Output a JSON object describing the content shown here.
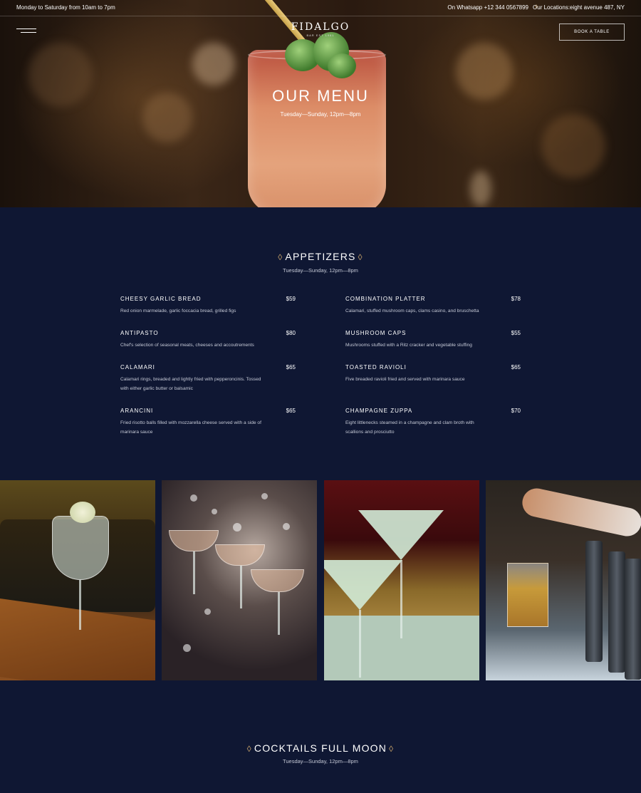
{
  "topbar": {
    "hours": "Monday to Saturday from 10am to 7pm",
    "whatsapp": "On Whatsapp +12 344 0567899",
    "location": "Our Locations:eight avenue 487, NY"
  },
  "logo": {
    "name": "FIDALGO",
    "tagline": "BAR EST 1961"
  },
  "book_button": "BOOK A TABLE",
  "hero": {
    "title": "OUR MENU",
    "subtitle": "Tuesday—Sunday, 12pm—8pm"
  },
  "appetizers": {
    "title": "APPETIZERS",
    "subtitle": "Tuesday—Sunday, 12pm—8pm",
    "items": [
      {
        "name": "CHEESY GARLIC BREAD",
        "price": "$59",
        "desc": "Red onion marmelade, garlic foccacia bread, grilled figs"
      },
      {
        "name": "COMBINATION PLATTER",
        "price": "$78",
        "desc": "Calamari, stuffed mushroom caps, clams casino, and bruschetta"
      },
      {
        "name": "ANTIPASTO",
        "price": "$80",
        "desc": "Chef's selection of seasonal meats, cheeses and accoutrements"
      },
      {
        "name": "MUSHROOM CAPS",
        "price": "$55",
        "desc": "Mushrooms stuffed with a Ritz cracker and vegetable stuffing"
      },
      {
        "name": "CALAMARI",
        "price": "$65",
        "desc": "Calamari rings, breaded and lightly fried with pepperoncinis. Tossed with either garlic butter or balsamic"
      },
      {
        "name": "TOASTED RAVIOLI",
        "price": "$65",
        "desc": "Five breaded ravioli fried and served with marinara sauce"
      },
      {
        "name": "ARANCINI",
        "price": "$65",
        "desc": "Fried risotto balls filled with mozzarella cheese served with a side of marinara sauce"
      },
      {
        "name": "CHAMPAGNE ZUPPA",
        "price": "$70",
        "desc": "Eight littlenecks steamed in a champagne and clam broth with scallions and prosciutto"
      }
    ]
  },
  "cocktails": {
    "title": "COCKTAILS FULL MOON",
    "subtitle": "Tuesday—Sunday, 12pm—8pm"
  },
  "colors": {
    "background": "#0f1733",
    "accent": "#c9a46a",
    "muted_text": "#c5c9d6"
  }
}
